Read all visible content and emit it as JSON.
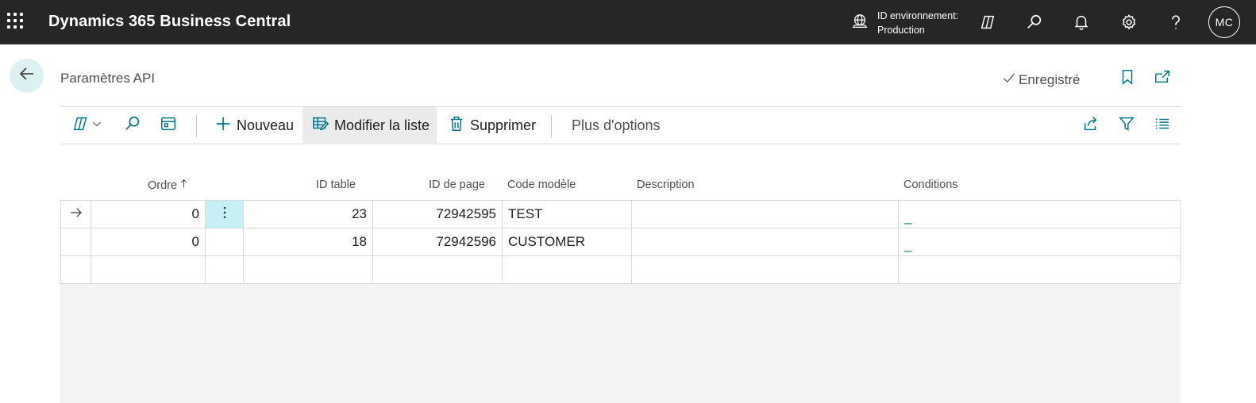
{
  "app": {
    "title": "Dynamics 365 Business Central",
    "environment_label": "ID environnement:",
    "environment_value": "Production",
    "user_initials": "MC"
  },
  "page": {
    "title": "Paramètres API",
    "saved_status": "Enregistré"
  },
  "actions": {
    "new_label": "Nouveau",
    "edit_list_label": "Modifier la liste",
    "delete_label": "Supprimer",
    "more_label": "Plus d'options"
  },
  "table": {
    "columns": {
      "order": "Ordre",
      "table_id": "ID table",
      "page_id": "ID de page",
      "template_code": "Code modèle",
      "description": "Description",
      "conditions": "Conditions"
    },
    "rows": [
      {
        "order": "0",
        "table_id": "23",
        "page_id": "72942595",
        "template_code": "TEST",
        "description": "",
        "conditions": "_"
      },
      {
        "order": "0",
        "table_id": "18",
        "page_id": "72942596",
        "template_code": "CUSTOMER",
        "description": "",
        "conditions": "_"
      }
    ]
  },
  "colors": {
    "topbar_bg": "#262626",
    "accent_teal": "#00758c",
    "selected_cell": "#c7f0f4",
    "back_button_bg": "#ddf1f3"
  }
}
